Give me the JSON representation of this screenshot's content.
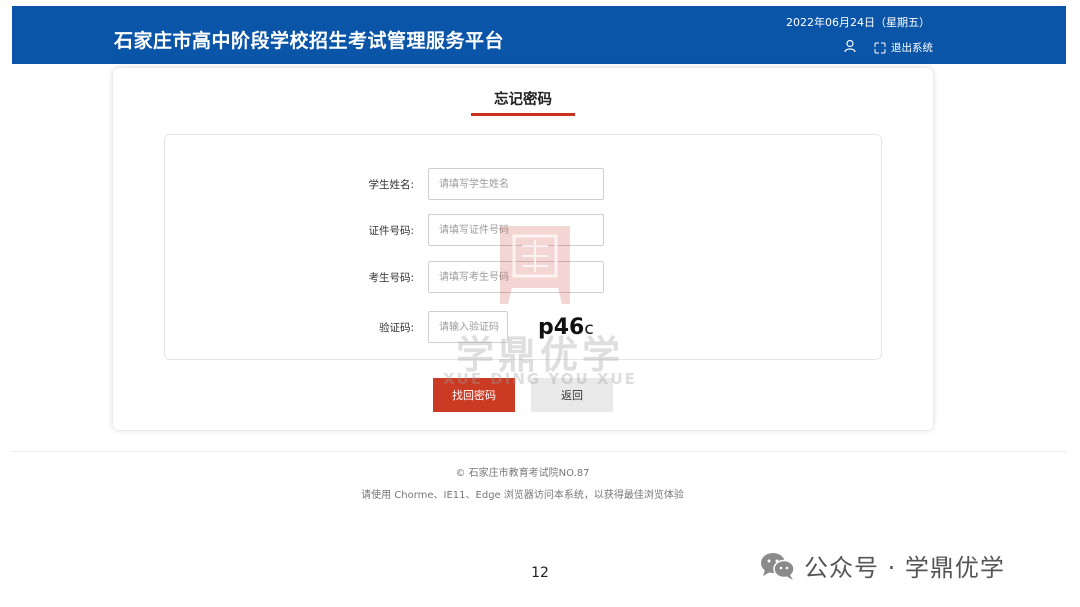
{
  "header": {
    "title": "石家庄市高中阶段学校招生考试管理服务平台",
    "date": "2022年06月24日（星期五）",
    "logout_label": "退出系统",
    "user_icon": "user-icon",
    "logout_icon": "exit-icon"
  },
  "card": {
    "title": "忘记密码",
    "accent_color": "#c9301e"
  },
  "form": {
    "fields": [
      {
        "label": "学生姓名:",
        "placeholder": "请填写学生姓名"
      },
      {
        "label": "证件号码:",
        "placeholder": "请填写证件号码"
      },
      {
        "label": "考生号码:",
        "placeholder": "请填写考生号码"
      }
    ],
    "captcha": {
      "label": "验证码:",
      "placeholder": "请输入验证码",
      "code_main": "p46",
      "code_tail": "c"
    }
  },
  "buttons": {
    "submit_label": "找回密码",
    "back_label": "返回"
  },
  "watermark": {
    "text": "学鼎优学",
    "sub": "XUE DING YOU XUE"
  },
  "footer": {
    "copyright": "© 石家庄市教育考试院NO.87",
    "note": "请使用 Chorme、IE11、Edge 浏览器访问本系统，以获得最佳浏览体验"
  },
  "page_number": "12",
  "wechat": {
    "label": "公众号 · 学鼎优学",
    "icon": "wechat-icon"
  },
  "colors": {
    "header_bg": "#0b55a8",
    "primary_button": "#cb3a22",
    "secondary_button": "#e9e9e9"
  }
}
